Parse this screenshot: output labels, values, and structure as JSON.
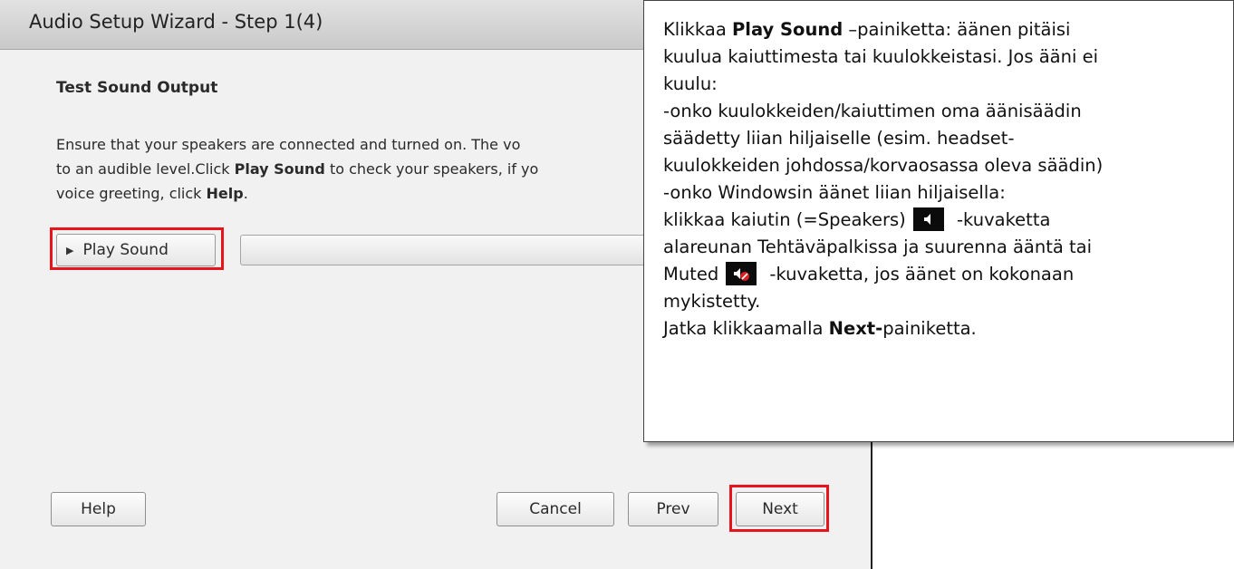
{
  "window": {
    "title": "Audio Setup Wizard - Step 1(4)"
  },
  "content": {
    "heading": "Test Sound Output",
    "description_line1": "Ensure that your speakers are connected and turned on. The vo",
    "description_line2_a": "to an audible level.Click ",
    "description_line2_b": "Play Sound",
    "description_line2_c": " to check your speakers, if yo",
    "description_line3_a": "voice greeting, click ",
    "description_line3_b": "Help",
    "description_line3_c": "."
  },
  "play_button": {
    "label": "Play Sound",
    "icon": "play-triangle-icon"
  },
  "footer": {
    "help_label": "Help",
    "cancel_label": "Cancel",
    "prev_label": "Prev",
    "next_label": "Next"
  },
  "callout": {
    "l1_a": "Klikkaa ",
    "l1_b": "Play Sound",
    "l1_c": " –painiketta: äänen pitäisi",
    "l2": "kuulua kaiuttimesta tai kuulokkeistasi. Jos ääni ei",
    "l3": "kuulu:",
    "l4": "-onko kuulokkeiden/kaiuttimen oma äänisäädin",
    "l5": "säädetty liian hiljaiselle (esim. headset-",
    "l6": "kuulokkeiden johdossa/korvaosassa oleva säädin)",
    "l7": "-onko Windowsin äänet liian hiljaisella:",
    "l8_a": "klikkaa kaiutin (=Speakers)",
    "l8_b": " -kuvaketta",
    "l9": "alareunan Tehtäväpalkissa ja suurenna ääntä tai",
    "l10_a": "Muted",
    "l10_b": " -kuvaketta, jos äänet on kokonaan",
    "l11": "mykistetty.",
    "l12_a": "Jatka klikkaamalla ",
    "l12_b": "Next-",
    "l12_c": "painiketta.",
    "speaker_icon": "speaker-icon",
    "muted_icon": "speaker-muted-icon"
  },
  "colors": {
    "highlight": "#e8141c",
    "dialog_bg": "#f1f1f1"
  }
}
